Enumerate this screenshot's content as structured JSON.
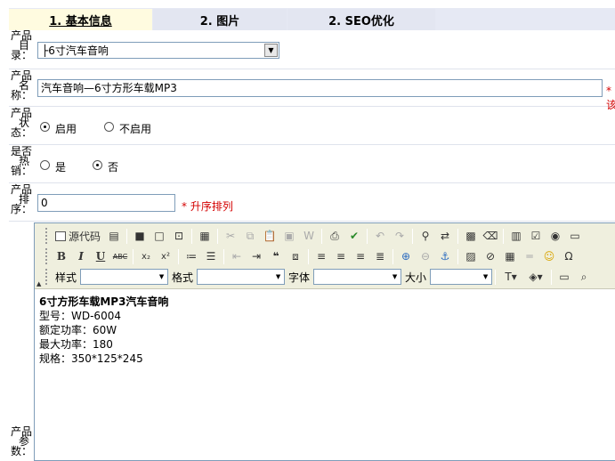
{
  "tabs": [
    {
      "label": "1. 基本信息",
      "active": true
    },
    {
      "label": "2. 图片",
      "active": false
    },
    {
      "label": "2. SEO优化",
      "active": false
    }
  ],
  "fields": {
    "category": {
      "label_lines": [
        "产品",
        "目",
        "录："
      ],
      "value": "├6寸汽车音响"
    },
    "name": {
      "label_lines": [
        "产品",
        "名",
        "称："
      ],
      "value": "汽车音响—6寸方形车载MP3",
      "hint": "*该"
    },
    "status": {
      "label_lines": [
        "产品",
        "状",
        "态："
      ],
      "options": [
        "启用",
        "不启用"
      ],
      "selected": "启用"
    },
    "hot": {
      "label_lines": [
        "是否",
        "热",
        "销："
      ],
      "options": [
        "是",
        "否"
      ],
      "selected": "否"
    },
    "sort": {
      "label_lines": [
        "产品",
        "排",
        "序："
      ],
      "value": "0",
      "hint": "* 升序排列"
    },
    "params": {
      "label_lines": [
        "产品",
        "参",
        "数："
      ]
    }
  },
  "toolbar": {
    "source_label": "源代码",
    "style_label": "样式",
    "format_label": "格式",
    "font_label": "字体",
    "size_label": "大小"
  },
  "editor": {
    "title": "6寸方形车载MP3汽车音响",
    "lines": [
      "型号：WD-6004",
      "额定功率：60W",
      "最大功率：180",
      "规格：350*125*245"
    ]
  },
  "colors": {
    "tab_active_bg": "#fffbe0",
    "tab_bg": "#e3e6f1",
    "hint": "#d40000",
    "toolbar_bg": "#efefde"
  }
}
